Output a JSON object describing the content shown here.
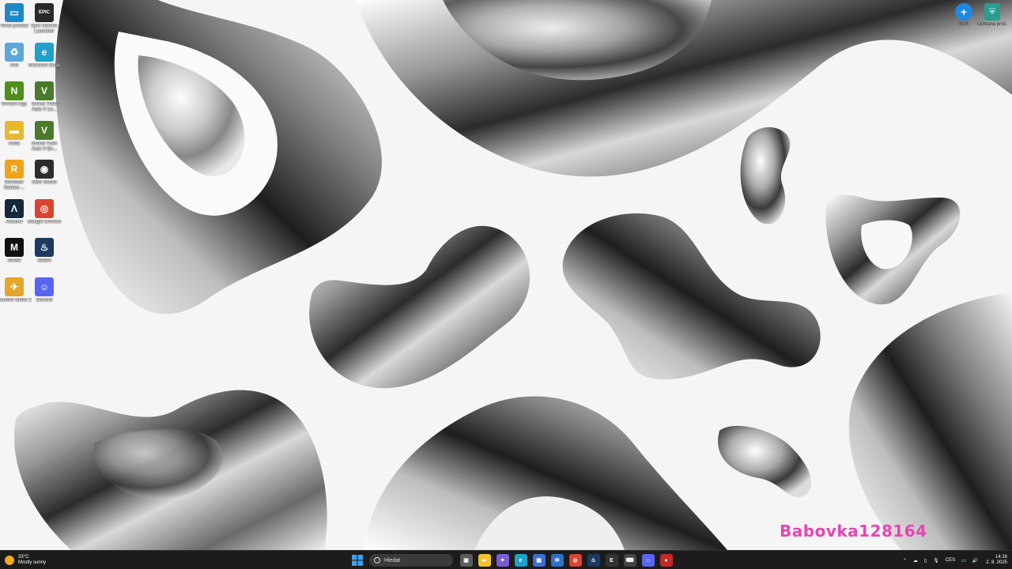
{
  "desktop": {
    "icons_col1": [
      {
        "label": "Tento počítač",
        "icon": "computer-icon",
        "color": "#1e88c7",
        "glyph": "▭"
      },
      {
        "label": "Koš",
        "icon": "recycle-bin-icon",
        "color": "#5aa7d8",
        "glyph": "♻"
      },
      {
        "label": "NVIDIA App",
        "icon": "nvidia-icon",
        "color": "#4f8f1a",
        "glyph": "N"
      },
      {
        "label": "Kuba",
        "icon": "folder-icon",
        "color": "#e8b730",
        "glyph": "▬"
      },
      {
        "label": "Rockstar Games ...",
        "icon": "rockstar-icon",
        "color": "#f0a21a",
        "glyph": "R"
      },
      {
        "label": "Arduino",
        "icon": "arduino-icon",
        "color": "#16283c",
        "glyph": "Λ"
      },
      {
        "label": "Medal",
        "icon": "medal-icon",
        "color": "#111111",
        "glyph": "M"
      },
      {
        "label": "Counter-Strike 2",
        "icon": "counter-strike-icon",
        "color": "#e3a62c",
        "glyph": "✈"
      }
    ],
    "icons_col2": [
      {
        "label": "Epic Games Launcher",
        "icon": "epic-games-icon",
        "color": "#2a2a2a",
        "glyph": "EPIC"
      },
      {
        "label": "Microsoft Edge",
        "icon": "edge-icon",
        "color": "#1fa1c9",
        "glyph": "e"
      },
      {
        "label": "Grand Theft Auto V Le...",
        "icon": "gta-v-icon",
        "color": "#4a7a2a",
        "glyph": "V"
      },
      {
        "label": "Grand Theft Auto V En...",
        "icon": "gta-v-enhanced-icon",
        "color": "#4a7a2a",
        "glyph": "V"
      },
      {
        "label": "OBS Studio",
        "icon": "obs-icon",
        "color": "#2c2c2c",
        "glyph": "◉"
      },
      {
        "label": "Google Chrome",
        "icon": "chrome-icon",
        "color": "#d9432f",
        "glyph": "◎"
      },
      {
        "label": "Steam",
        "icon": "steam-icon",
        "color": "#1b3b5f",
        "glyph": "♨"
      },
      {
        "label": "Discord",
        "icon": "discord-icon",
        "color": "#5865f2",
        "glyph": "☺"
      }
    ],
    "top_right": [
      {
        "label": "SOS",
        "icon": "sos-icon",
        "color": "#1e88e5"
      },
      {
        "label": "Ochrana proti...",
        "icon": "protection-icon",
        "color": "#2a9d8f"
      }
    ],
    "watermark": "Babovka128164"
  },
  "taskbar": {
    "weather_temp": "33°C",
    "weather_desc": "Mostly sunny",
    "search_placeholder": "Hledat",
    "apps": [
      {
        "name": "task-view-icon",
        "color": "#5c5c5c",
        "glyph": "▣"
      },
      {
        "name": "file-explorer-icon",
        "color": "#f2c230",
        "glyph": "▰"
      },
      {
        "name": "copilot-icon",
        "color": "#7b5cd6",
        "glyph": "✦"
      },
      {
        "name": "edge-taskbar-icon",
        "color": "#1fa1c9",
        "glyph": "e"
      },
      {
        "name": "store-icon",
        "color": "#3b6fd1",
        "glyph": "▦"
      },
      {
        "name": "mail-icon",
        "color": "#2d72c9",
        "glyph": "✉"
      },
      {
        "name": "chrome-taskbar-icon",
        "color": "#d9432f",
        "glyph": "◎"
      },
      {
        "name": "steam-taskbar-icon",
        "color": "#1b3b5f",
        "glyph": "♨"
      },
      {
        "name": "epic-taskbar-icon",
        "color": "#333333",
        "glyph": "E"
      },
      {
        "name": "gamepad-icon",
        "color": "#444444",
        "glyph": "⌨"
      },
      {
        "name": "discord-taskbar-icon",
        "color": "#5865f2",
        "glyph": "☺"
      },
      {
        "name": "recorder-icon",
        "color": "#c22a2a",
        "glyph": "●"
      }
    ],
    "lang": "CES",
    "time": "14:16",
    "date": "2. 8. 2025"
  }
}
